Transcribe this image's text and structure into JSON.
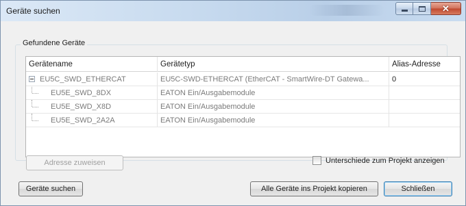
{
  "window": {
    "title": "Geräte suchen"
  },
  "group": {
    "legend": "Gefundene Geräte"
  },
  "table": {
    "columns": [
      "Gerätename",
      "Gerätetyp",
      "Alias-Adresse"
    ],
    "rows": [
      {
        "name": "EU5C_SWD_ETHERCAT",
        "type": "EU5C-SWD-ETHERCAT (EtherCAT - SmartWire-DT Gatewa...",
        "alias": "0",
        "level": 0
      },
      {
        "name": "EU5E_SWD_8DX",
        "type": "EATON Ein/Ausgabemodule",
        "alias": "",
        "level": 1
      },
      {
        "name": "EU5E_SWD_X8D",
        "type": "EATON Ein/Ausgabemodule",
        "alias": "",
        "level": 1
      },
      {
        "name": "EU5E_SWD_2A2A",
        "type": "EATON Ein/Ausgabemodule",
        "alias": "",
        "level": 1
      }
    ]
  },
  "buttons": {
    "assign_address": "Adresse zuweisen",
    "search_devices": "Geräte suchen",
    "copy_all": "Alle Geräte ins Projekt kopieren",
    "close": "Schließen"
  },
  "checkbox": {
    "label": "Unterschiede zum Projekt anzeigen",
    "checked": false
  },
  "icons": {
    "minimize": "minimize-icon",
    "maximize": "maximize-icon",
    "close": "close-icon",
    "tree_toggle": "collapse-icon"
  },
  "colors": {
    "close_button": "#c0482e",
    "default_button_border": "#3c7fb1"
  }
}
